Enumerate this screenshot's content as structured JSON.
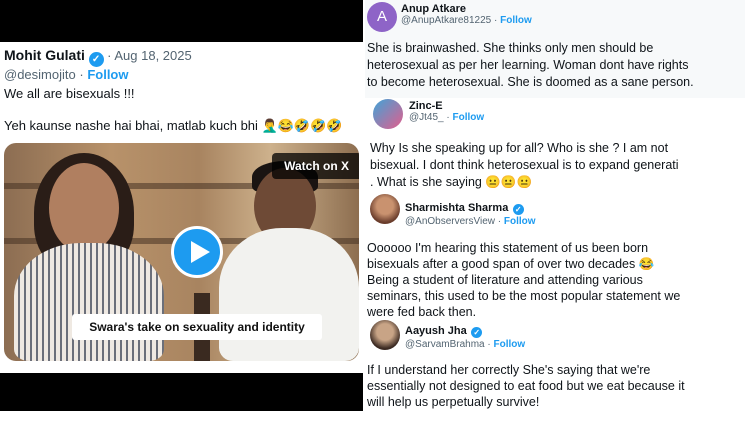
{
  "main_tweet": {
    "author_name": "Mohit Gulati",
    "date": "· Aug 18, 2025",
    "handle": "@desimojito",
    "follow_label": "Follow",
    "line1": "We all are bisexuals !!!",
    "line2": "Yeh kaunse nashe hai bhai, matlab kuch bhi",
    "line2_emojis": "🤦‍♂️😂🤣🤣🤣",
    "video": {
      "watch_label": "Watch on X",
      "caption": "Swara's take on sexuality and identity"
    }
  },
  "replies": [
    {
      "avatar_letter": "A",
      "author_name": "Anup Atkare",
      "handle": "@AnupAtkare81225",
      "follow_label": "Follow",
      "lines": [
        "She is brainwashed. She thinks only men should be",
        "heterosexual as per her learning. Woman dont have rights",
        "to become heterosexual.  She is doomed as a sane person."
      ]
    },
    {
      "author_name": "Zinc-E",
      "handle": "@Jt45_",
      "follow_label": "Follow",
      "lines": [
        "Why Is she speaking up for all? Who is she ? I am not",
        "bisexual. I dont think heterosexual is to expand generati",
        ". What is she saying"
      ],
      "emojis": "😐😐😐"
    },
    {
      "author_name": "Sharmishta Sharma",
      "handle": "@AnObserversView",
      "follow_label": "Follow",
      "lines": [
        "Oooooo I'm hearing this statement of us been born",
        "bisexuals after a good span of over two decades",
        "Being a student of literature and attending various",
        "seminars, this used to be the most popular statement we",
        "were fed back then."
      ],
      "emojis": "😂"
    },
    {
      "author_name": "Aayush Jha",
      "handle": "@SarvamBrahma",
      "follow_label": "Follow",
      "lines": [
        "If I understand her correctly She's saying that we're",
        "essentially not designed to eat food but we eat because it",
        "will help us perpetually survive!"
      ]
    }
  ],
  "colors": {
    "accent": "#1d9bf0",
    "secondary_text": "#536471"
  }
}
